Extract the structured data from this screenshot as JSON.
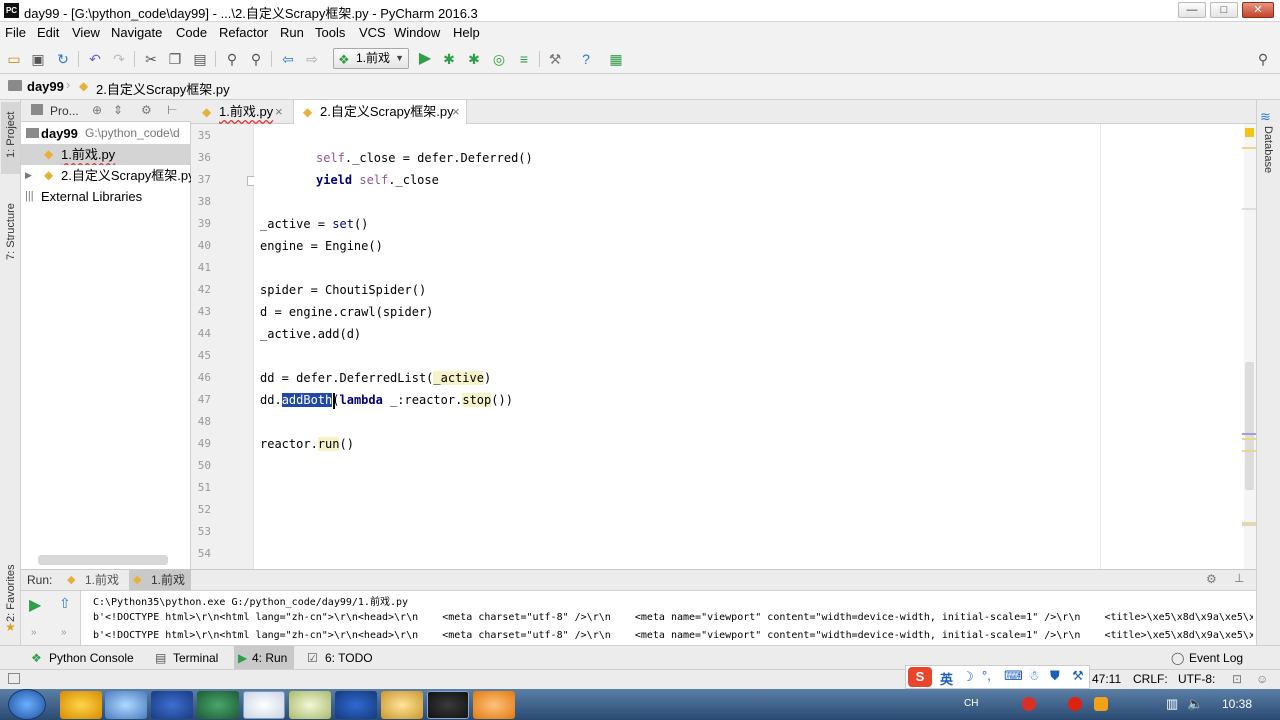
{
  "window": {
    "title": "day99 - [G:\\python_code\\day99] - ...\\2.自定义Scrapy框架.py - PyCharm 2016.3",
    "app_icon": "PC",
    "minimize": "—",
    "maximize": "□",
    "close": "✕"
  },
  "menu": [
    "File",
    "Edit",
    "View",
    "Navigate",
    "Code",
    "Refactor",
    "Run",
    "Tools",
    "VCS",
    "Window",
    "Help"
  ],
  "toolbar": {
    "run_config": "1.前戏"
  },
  "breadcrumb": [
    "day99",
    "2.自定义Scrapy框架.py"
  ],
  "sidestrip": {
    "project": "1: Project",
    "structure": "7: Structure",
    "favorites": "2: Favorites",
    "database": "Database"
  },
  "project": {
    "header_label": "Pro...",
    "root_name": "day99",
    "root_path": "G:\\python_code\\d",
    "files": [
      "1.前戏.py",
      "2.自定义Scrapy框架.py"
    ],
    "external": "External Libraries"
  },
  "tabs": [
    {
      "label": "1.前戏.py",
      "close": "×",
      "active": false
    },
    {
      "label": "2.自定义Scrapy框架.py",
      "close": "×",
      "active": true
    }
  ],
  "line_numbers": [
    "35",
    "36",
    "37",
    "38",
    "39",
    "40",
    "41",
    "42",
    "43",
    "44",
    "45",
    "46",
    "47",
    "48",
    "49",
    "50",
    "51",
    "52",
    "53",
    "54"
  ],
  "code": {
    "l36_self": "self",
    "l36_rest": "._close = defer.Deferred()",
    "l37_yield": "yield",
    "l37_self": "self",
    "l37_rest": "._close",
    "l39_a": "_active = ",
    "l39_set": "set",
    "l39_b": "()",
    "l40": "engine = Engine()",
    "l42": "spider = ChoutiSpider()",
    "l43": "d = engine.crawl(spider)",
    "l44": "_active.add(d)",
    "l46_a": "dd = defer.DeferredList(",
    "l46_hl": "_active",
    "l46_b": ")",
    "l47_a": "dd.",
    "l47_sel": "addBoth",
    "l47_b": "(",
    "l47_lambda": "lambda",
    "l47_c": " _:reactor.",
    "l47_stop": "stop",
    "l47_d": "())",
    "l49_a": "reactor.",
    "l49_run": "run",
    "l49_b": "()"
  },
  "run": {
    "label": "Run:",
    "tabs": [
      "1.前戏",
      "1.前戏"
    ],
    "lines": [
      "C:\\Python35\\python.exe G:/python_code/day99/1.前戏.py",
      "b'<!DOCTYPE html>\\r\\n<html lang=\"zh-cn\">\\r\\n<head>\\r\\n    <meta charset=\"utf-8\" />\\r\\n    <meta name=\"viewport\" content=\"width=device-width, initial-scale=1\" />\\r\\n    <title>\\xe5\\x8d\\x9a\\xe5\\x",
      "b'<!DOCTYPE html>\\r\\n<html lang=\"zh-cn\">\\r\\n<head>\\r\\n    <meta charset=\"utf-8\" />\\r\\n    <meta name=\"viewport\" content=\"width=device-width, initial-scale=1\" />\\r\\n    <title>\\xe5\\x8d\\x9a\\xe5\\x"
    ]
  },
  "bottom_tabs": [
    "Python Console",
    "Terminal",
    "4: Run",
    "6: TODO"
  ],
  "event_log": "Event Log",
  "status": {
    "position": "47:11",
    "line_sep": "CRLF:",
    "encoding": "UTF-8:"
  },
  "ime": {
    "label": "英"
  },
  "tray": {
    "lang": "CH",
    "time": "10:38"
  }
}
